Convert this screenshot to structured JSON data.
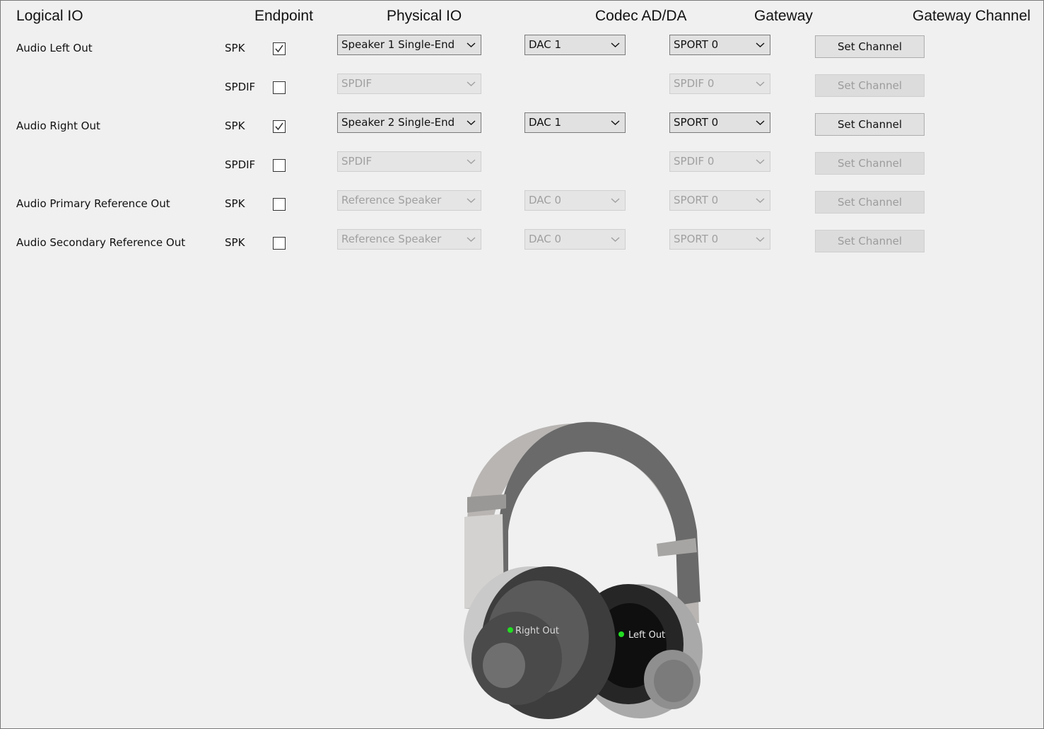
{
  "headers": {
    "logical_io": "Logical IO",
    "endpoint": "Endpoint",
    "physical_io": "Physical IO",
    "codec": "Codec AD/DA",
    "gateway": "Gateway",
    "gateway_channel": "Gateway Channel"
  },
  "rows": [
    {
      "logical": "Audio Left Out",
      "endpoint": "SPK",
      "checked": true,
      "physical": "Speaker 1 Single-End",
      "codec": "DAC 1",
      "gateway": "SPORT 0",
      "button": "Set Channel",
      "enabled": true
    },
    {
      "logical": "",
      "endpoint": "SPDIF",
      "checked": false,
      "physical": "SPDIF",
      "codec": "",
      "gateway": "SPDIF 0",
      "button": "Set Channel",
      "enabled": false
    },
    {
      "logical": "Audio Right Out",
      "endpoint": "SPK",
      "checked": true,
      "physical": "Speaker 2 Single-End",
      "codec": "DAC 1",
      "gateway": "SPORT 0",
      "button": "Set Channel",
      "enabled": true
    },
    {
      "logical": "",
      "endpoint": "SPDIF",
      "checked": false,
      "physical": "SPDIF",
      "codec": "",
      "gateway": "SPDIF 0",
      "button": "Set Channel",
      "enabled": false
    },
    {
      "logical": "Audio Primary Reference Out",
      "endpoint": "SPK",
      "checked": false,
      "physical": "Reference Speaker",
      "codec": "DAC 0",
      "gateway": "SPORT 0",
      "button": "Set Channel",
      "enabled": false
    },
    {
      "logical": "Audio Secondary Reference Out",
      "endpoint": "SPK",
      "checked": false,
      "physical": "Reference Speaker",
      "codec": "DAC 0",
      "gateway": "SPORT 0",
      "button": "Set Channel",
      "enabled": false
    }
  ],
  "headphones": {
    "right_label": "Right Out",
    "left_label": "Left Out",
    "indicator_color": "#22dd22"
  },
  "icons": {
    "checkbox_mark": "checkmark-icon",
    "dropdown_arrow": "chevron-down-icon"
  }
}
